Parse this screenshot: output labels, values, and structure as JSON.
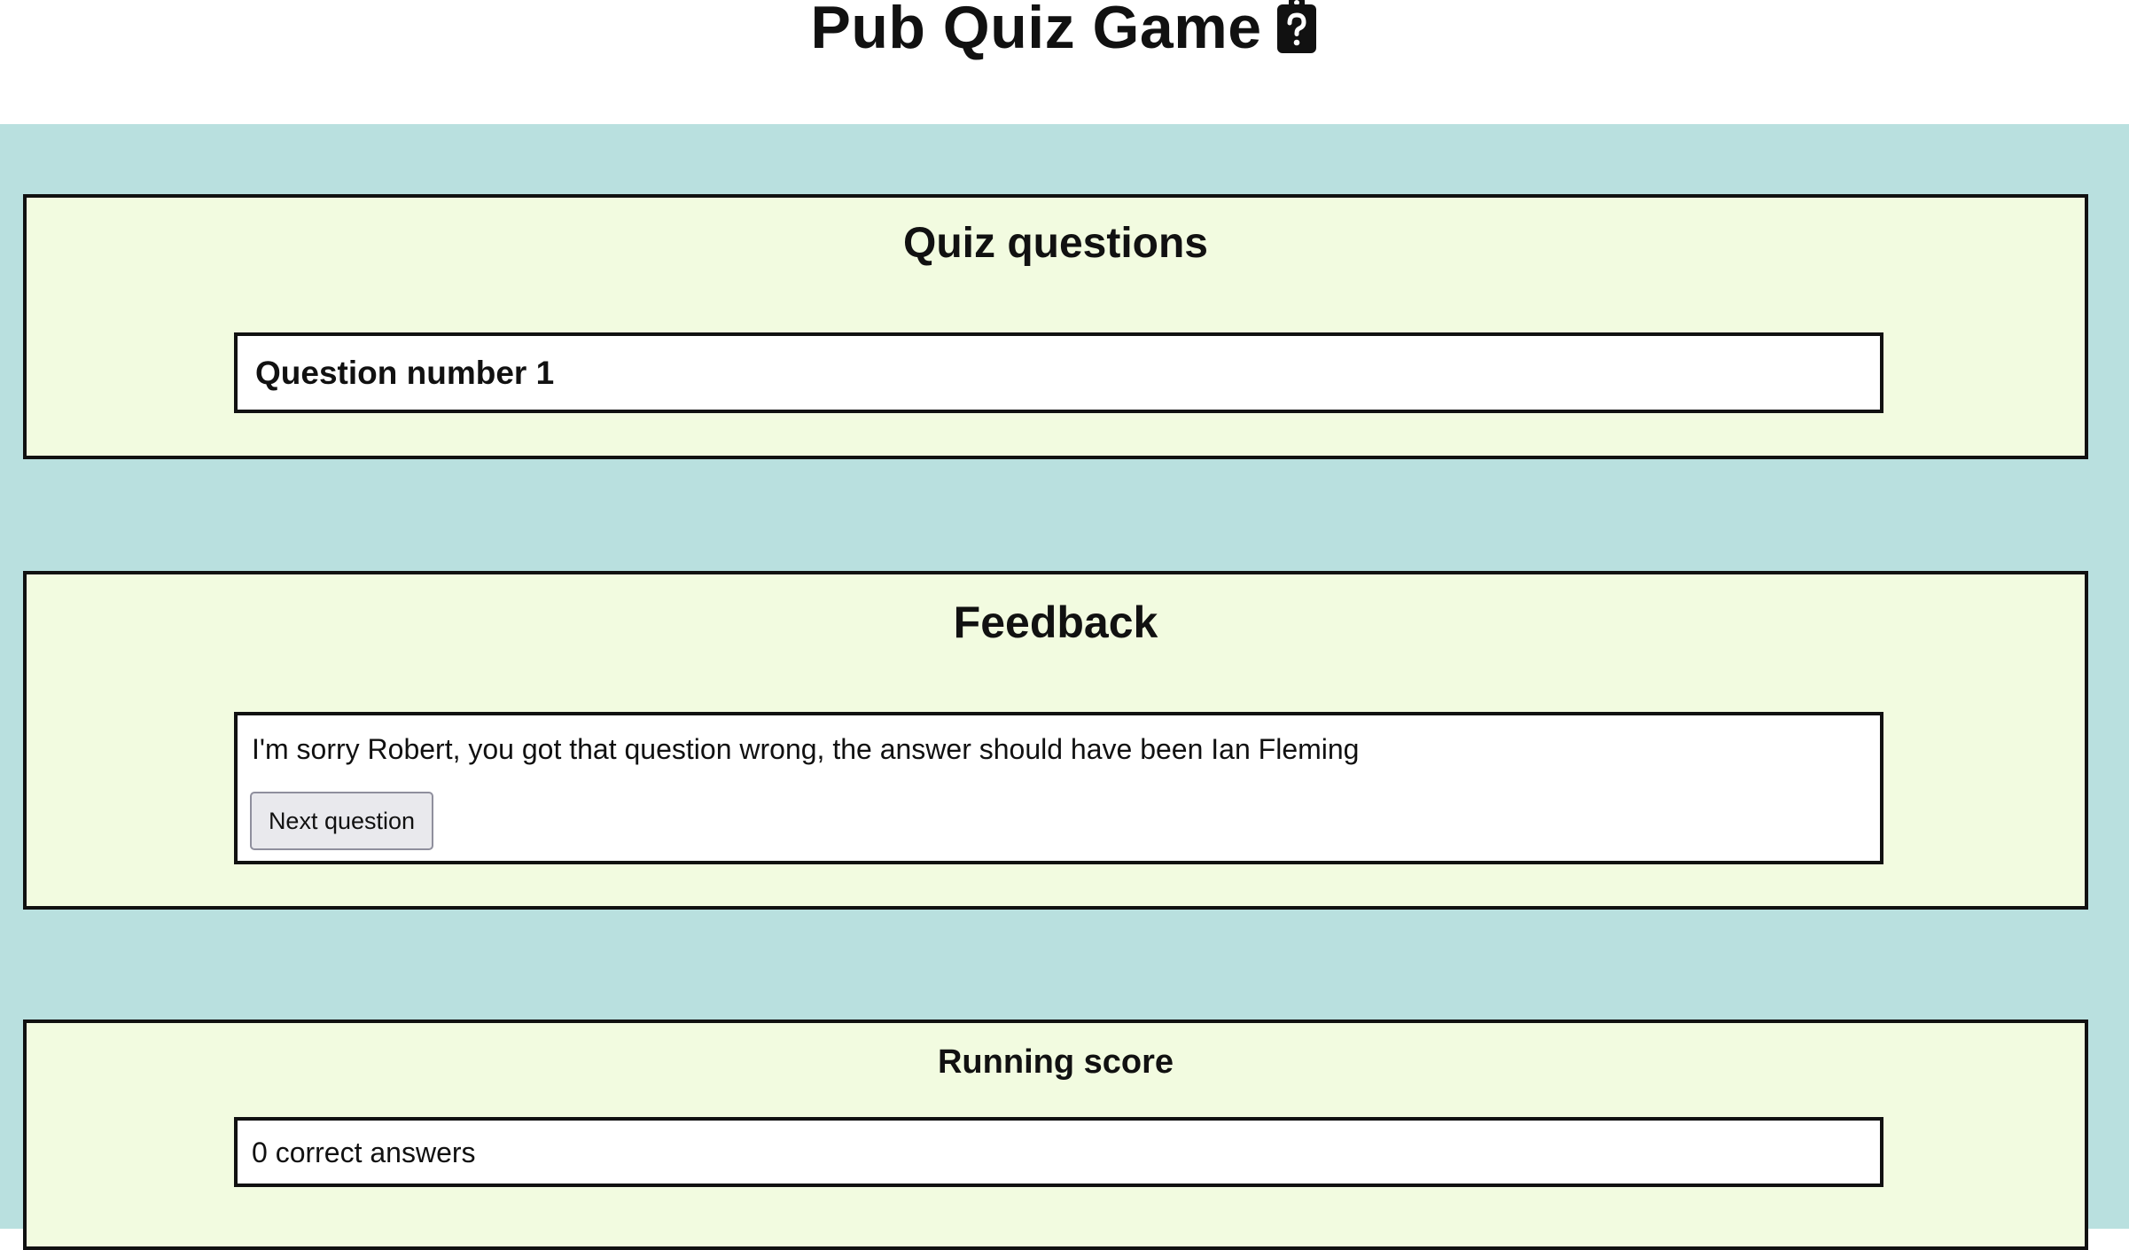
{
  "header": {
    "title": "Pub Quiz Game",
    "icon": "clipboard-question-icon"
  },
  "questions_panel": {
    "heading": "Quiz questions",
    "question_label": "Question number 1"
  },
  "feedback_panel": {
    "heading": "Feedback",
    "message": "I'm sorry Robert, you got that question wrong, the answer should have been Ian Fleming",
    "next_button_label": "Next question"
  },
  "score_panel": {
    "heading": "Running score",
    "score_text": "0 correct answers"
  },
  "colors": {
    "page_background": "#b9e0df",
    "panel_background": "#f2fbe0",
    "box_background": "#ffffff",
    "border": "#111111"
  }
}
